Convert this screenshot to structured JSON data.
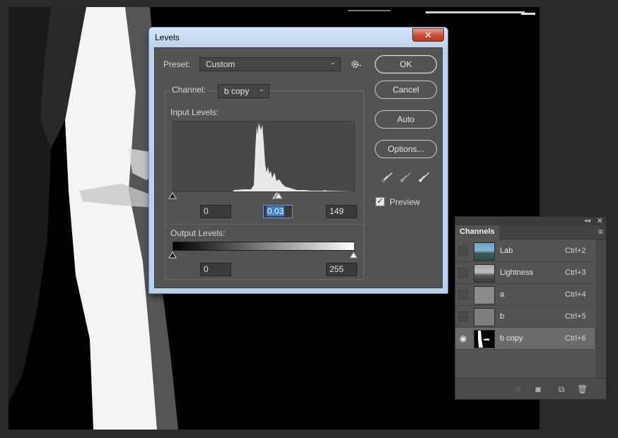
{
  "levels": {
    "title": "Levels",
    "close_label": "✕",
    "preset_label": "Preset:",
    "preset_value": "Custom",
    "channel_label": "Channel:",
    "channel_value": "b copy",
    "input_levels_label": "Input Levels:",
    "input_black": "0",
    "input_gamma": "0.03",
    "input_white": "149",
    "output_levels_label": "Output Levels:",
    "output_black": "0",
    "output_white": "255",
    "buttons": {
      "ok": "OK",
      "cancel": "Cancel",
      "auto": "Auto",
      "options": "Options..."
    },
    "preview_label": "Preview",
    "preview_checked": true
  },
  "channels": {
    "tab_label": "Channels",
    "rows": [
      {
        "name": "Lab",
        "shortcut": "Ctrl+2",
        "visible": false,
        "active": false
      },
      {
        "name": "Lightness",
        "shortcut": "Ctrl+3",
        "visible": false,
        "active": false
      },
      {
        "name": "a",
        "shortcut": "Ctrl+4",
        "visible": false,
        "active": false
      },
      {
        "name": "b",
        "shortcut": "Ctrl+5",
        "visible": false,
        "active": false
      },
      {
        "name": "b copy",
        "shortcut": "Ctrl+6",
        "visible": true,
        "active": true
      }
    ]
  },
  "icons": {
    "gear": "gear-icon",
    "dropdown": "chevron-down-icon",
    "black_point": "eyedropper-black-icon",
    "gray_point": "eyedropper-gray-icon",
    "white_point": "eyedropper-white-icon",
    "eye": "eye-icon"
  },
  "colors": {
    "dialog_frame": "#b9d1ea",
    "panel_bg": "#535353",
    "selection": "#3f7cc9",
    "close_button": "#c9503a"
  }
}
